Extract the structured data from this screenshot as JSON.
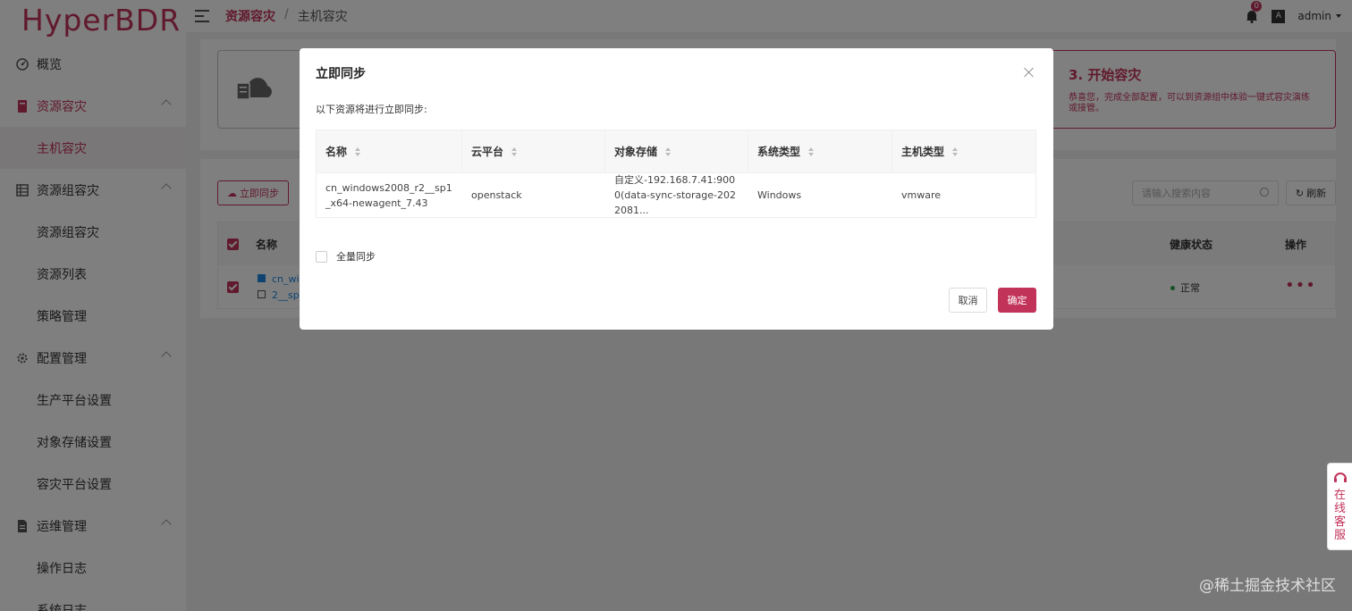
{
  "app": {
    "logo": "HyperBDR"
  },
  "sidebar": {
    "groups": [
      {
        "label": "概览",
        "items": []
      },
      {
        "label": "资源容灾",
        "items": [
          "主机容灾"
        ]
      },
      {
        "label": "资源组容灾",
        "items": [
          "资源组容灾",
          "资源列表",
          "策略管理"
        ]
      },
      {
        "label": "配置管理",
        "items": [
          "生产平台设置",
          "对象存储设置",
          "容灾平台设置"
        ]
      },
      {
        "label": "运维管理",
        "items": [
          "操作日志",
          "系统日志"
        ]
      }
    ]
  },
  "breadcrumb": {
    "first": "资源容灾",
    "separator": "/",
    "second": "主机容灾"
  },
  "header": {
    "notification_count": "0",
    "lang": "A",
    "user": "admin"
  },
  "main": {
    "step3_title": "3. 开始容灾",
    "step3_desc": "恭喜您，完成全部配置，可以到资源组中体验一键式容灾演练或接管。",
    "sync_button": "立即同步",
    "search_placeholder": "请输入搜索内容",
    "refresh_button": "刷新",
    "table": {
      "col_name": "名称",
      "col_health": "健康状态",
      "col_action": "操作",
      "row_name_1": "cn_wir",
      "row_name_2": "2__sp1",
      "row_health": "正常"
    }
  },
  "modal": {
    "title": "立即同步",
    "description": "以下资源将进行立即同步:",
    "columns": [
      "名称",
      "云平台",
      "对象存储",
      "系统类型",
      "主机类型"
    ],
    "rows": [
      [
        "cn_windows2008_r2__sp1_x64-newagent_7.43",
        "openstack",
        "自定义-192.168.7.41:9000(data-sync-storage-2022081...",
        "Windows",
        "vmware"
      ]
    ],
    "full_sync_label": "全量同步",
    "cancel": "取消",
    "ok": "确定"
  },
  "floating": {
    "online_service": "在线客服"
  },
  "watermark": "@稀土掘金技术社区",
  "colors": {
    "brand": "#c2335a"
  }
}
